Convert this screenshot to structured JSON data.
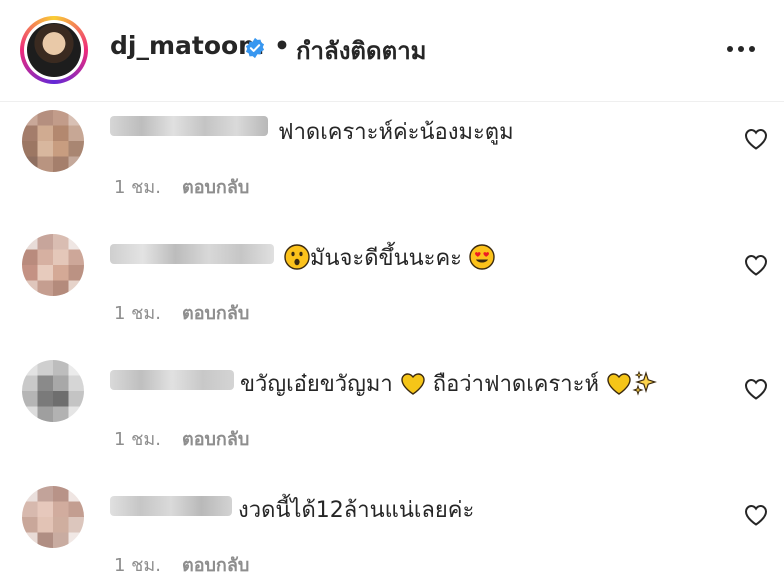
{
  "header": {
    "username": "dj_matoom",
    "separator": "•",
    "follow_status": "กำลังติดตาม",
    "more_label": "•••"
  },
  "comments": [
    {
      "text": "ฟาดเคราะห์ค่ะน้องมะตูม",
      "time": "1 ชม.",
      "reply": "ตอบกลับ"
    },
    {
      "text_before": "",
      "text": "มันจะดีขึ้นนะคะ",
      "time": "1 ชม.",
      "reply": "ตอบกลับ"
    },
    {
      "text": "ขวัญเอ๋ยขวัญมา",
      "text_2": "ถือว่าฟาดเคราะห์",
      "time": "1 ชม.",
      "reply": "ตอบกลับ"
    },
    {
      "text": "งวดนี้ได้12ล้านแน่เลยค่ะ",
      "time": "1 ชม.",
      "reply": "ตอบกลับ"
    }
  ],
  "icons": {
    "verified": "verified-badge-icon",
    "more": "more-options-icon",
    "like": "heart-outline-icon"
  },
  "colors": {
    "verified": "#3897f0",
    "secondary_text": "#8e8e8e",
    "heart_emoji": "#f5c518"
  }
}
